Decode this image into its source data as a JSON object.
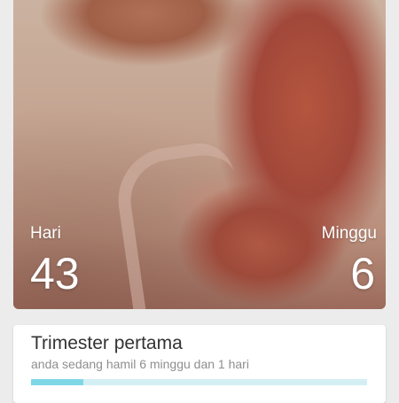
{
  "hero": {
    "days_label": "Hari",
    "days_value": "43",
    "weeks_label": "Minggu",
    "weeks_value": "6"
  },
  "trimester_card": {
    "title": "Trimester pertama",
    "subtitle": "anda sedang hamil 6 minggu dan 1 hari",
    "progress": 0.155
  },
  "colors": {
    "accent": "#7fd7e6",
    "track": "#d3eff4"
  }
}
